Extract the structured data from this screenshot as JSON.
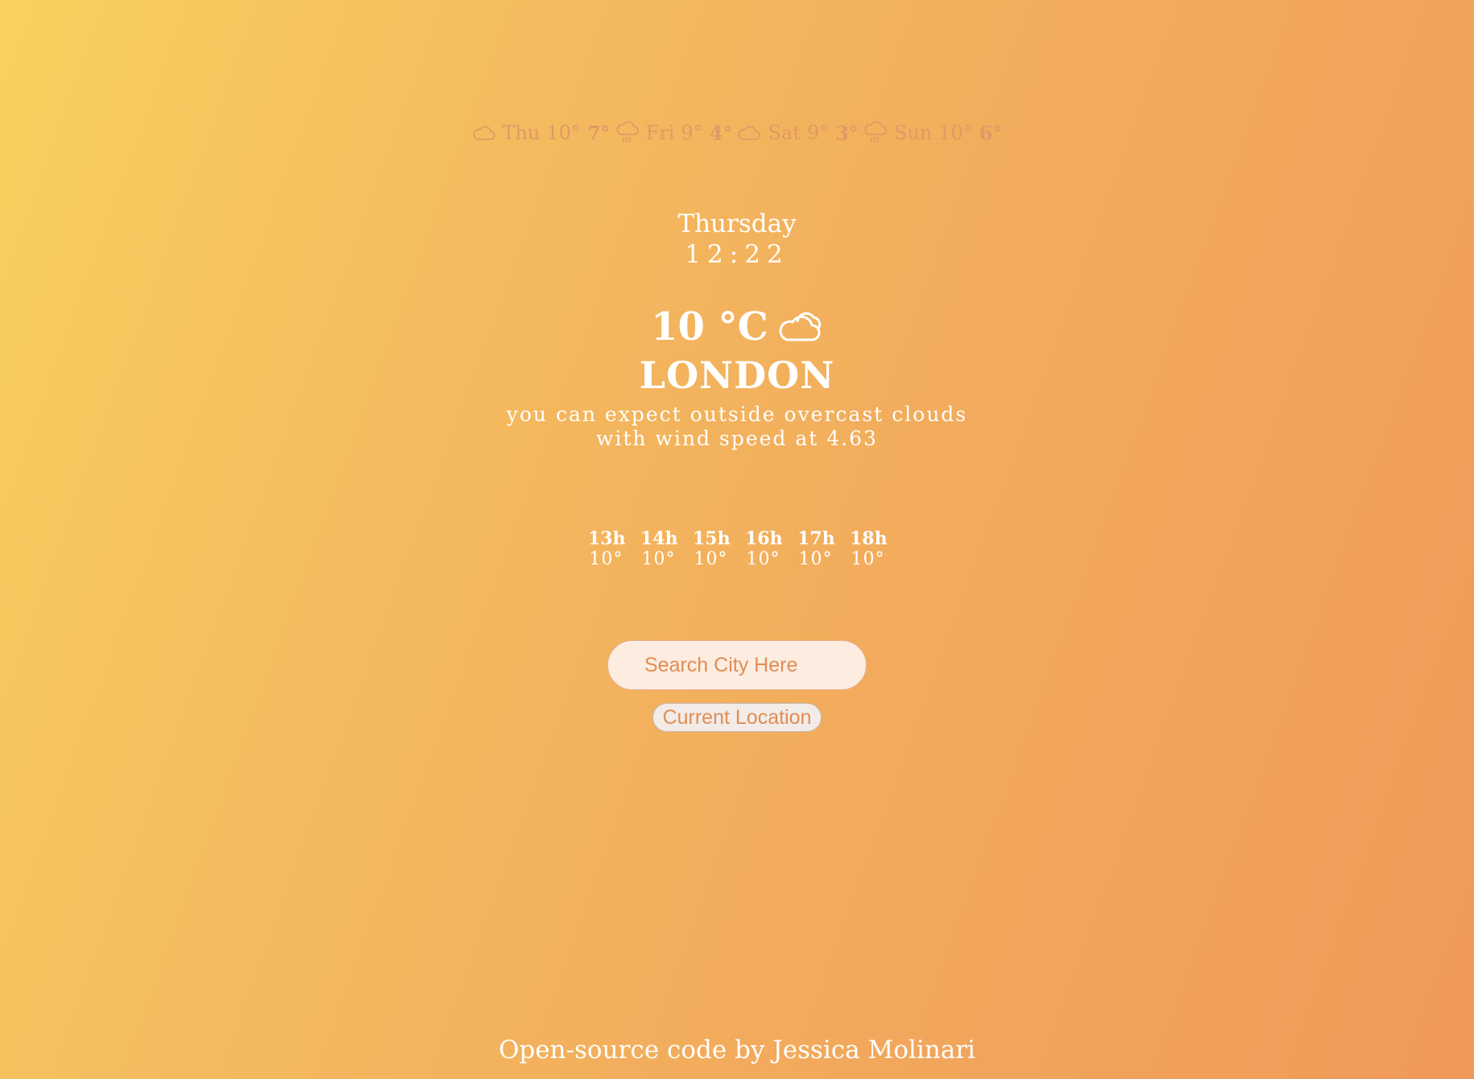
{
  "forecast": [
    {
      "icon": "cloud-icon",
      "day": "Thu",
      "high": "10°",
      "low": "7°"
    },
    {
      "icon": "rain-cloud-icon",
      "day": "Fri",
      "high": "9°",
      "low": "4°"
    },
    {
      "icon": "cloud-icon",
      "day": "Sat",
      "high": "9°",
      "low": "3°"
    },
    {
      "icon": "rain-cloud-icon",
      "day": "Sun",
      "high": "10°",
      "low": "6°"
    }
  ],
  "current": {
    "day": "Thursday",
    "time": "12:22",
    "temperature": "10 °C",
    "condition_icon": "cloud-icon",
    "city": "LONDON",
    "description": "you can expect outside overcast clouds with wind speed at 4.63"
  },
  "hourly": [
    {
      "hour": "13h",
      "temp": "10°"
    },
    {
      "hour": "14h",
      "temp": "10°"
    },
    {
      "hour": "15h",
      "temp": "10°"
    },
    {
      "hour": "16h",
      "temp": "10°"
    },
    {
      "hour": "17h",
      "temp": "10°"
    },
    {
      "hour": "18h",
      "temp": "10°"
    }
  ],
  "search": {
    "placeholder": "Search City Here",
    "current_location_label": "Current Location"
  },
  "footer": {
    "text": "Open-source code by Jessica Molinari"
  },
  "colors": {
    "forecast_text": "#e19a66",
    "accent": "#e08d55",
    "text": "#ffffff"
  }
}
